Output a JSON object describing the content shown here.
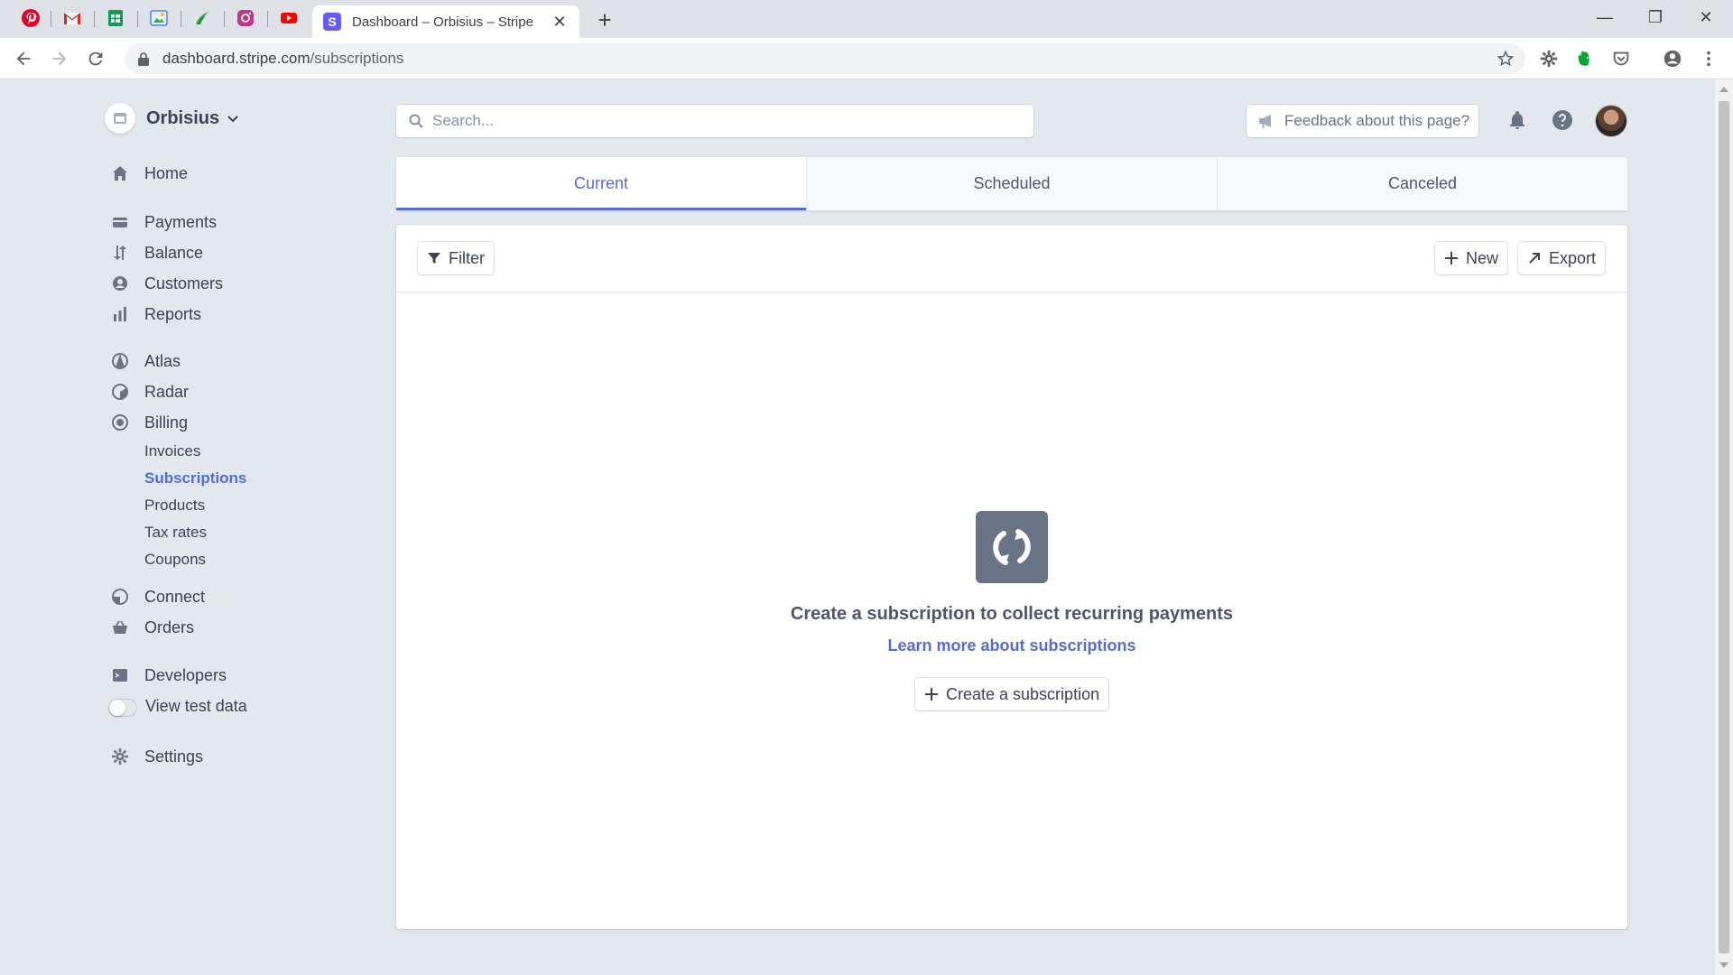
{
  "browser": {
    "pinned_tabs": [
      {
        "icon": "pinterest-icon",
        "color": "#e60023"
      },
      {
        "icon": "gmail-icon",
        "color": "#d93025"
      },
      {
        "icon": "google-sheets-icon",
        "color": "#0f9d58"
      },
      {
        "icon": "maps-icon",
        "color": "#4285f4"
      },
      {
        "icon": "feedly-icon",
        "color": "#2bb24c"
      },
      {
        "icon": "instagram-icon",
        "color": "#c13584"
      },
      {
        "icon": "youtube-icon",
        "color": "#ff0000"
      }
    ],
    "active_tab": {
      "favicon_letter": "S",
      "title": "Dashboard – Orbisius – Stripe",
      "close": "✕"
    },
    "new_tab": "+",
    "url_host": "dashboard.stripe.com",
    "url_path": "/subscriptions",
    "window_controls": {
      "minimize": "—",
      "maximize": "❐",
      "close": "✕"
    }
  },
  "account": {
    "name": "Orbisius"
  },
  "header": {
    "search_placeholder": "Search...",
    "feedback_label": "Feedback about this page?"
  },
  "sidebar": {
    "home": "Home",
    "payments": "Payments",
    "balance": "Balance",
    "customers": "Customers",
    "reports": "Reports",
    "atlas": "Atlas",
    "radar": "Radar",
    "billing": "Billing",
    "billing_sub": {
      "invoices": "Invoices",
      "subscriptions": "Subscriptions",
      "products": "Products",
      "tax_rates": "Tax rates",
      "coupons": "Coupons"
    },
    "connect": "Connect",
    "orders": "Orders",
    "developers": "Developers",
    "view_test_data": "View test data",
    "settings": "Settings"
  },
  "tabs": {
    "current": "Current",
    "scheduled": "Scheduled",
    "canceled": "Canceled"
  },
  "toolbar": {
    "filter": "Filter",
    "new": "New",
    "export": "Export"
  },
  "empty_state": {
    "title": "Create a subscription to collect recurring payments",
    "link": "Learn more about subscriptions",
    "button": "Create a subscription"
  },
  "colors": {
    "accent": "#556cd6",
    "stripe_brand": "#635bff",
    "page_bg": "#e3e8ee"
  }
}
